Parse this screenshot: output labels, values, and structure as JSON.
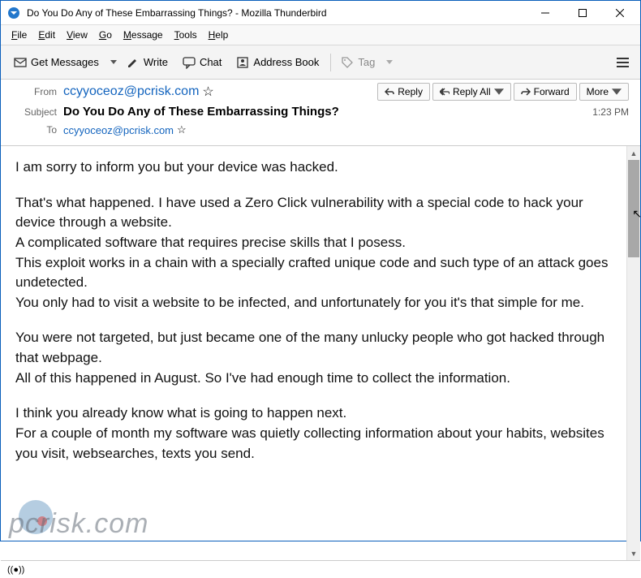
{
  "window": {
    "title": "Do You Do Any of These Embarrassing Things? - Mozilla Thunderbird"
  },
  "menubar": {
    "file": "File",
    "edit": "Edit",
    "view": "View",
    "go": "Go",
    "message": "Message",
    "tools": "Tools",
    "help": "Help"
  },
  "toolbar": {
    "get": "Get Messages",
    "write": "Write",
    "chat": "Chat",
    "addrbook": "Address Book",
    "tag": "Tag"
  },
  "actions": {
    "reply": "Reply",
    "replyall": "Reply All",
    "forward": "Forward",
    "more": "More"
  },
  "headers": {
    "from_label": "From",
    "from": "ccyyoceoz@pcrisk.com",
    "subject_label": "Subject",
    "subject": "Do You Do Any of These Embarrassing Things?",
    "to_label": "To",
    "to": "ccyyoceoz@pcrisk.com",
    "time": "1:23 PM"
  },
  "body": {
    "p1": "I am sorry to inform you but your device was hacked.",
    "p2": "That's what happened. I have used a Zero Click vulnerability with a special code to hack your device through a website.\nA complicated software that requires precise skills that I posess.\nThis exploit works in a chain with a specially crafted unique code and such type of an attack goes undetected.\nYou only had to visit a website to be infected, and unfortunately for you it's that simple for me.",
    "p3": "You were not targeted, but just became one of the many unlucky people who got hacked through that webpage.\nAll of this happened in August. So I've had enough time to collect the information.",
    "p4": "I think you already know what is going to happen next.\nFor a couple of month my software was quietly collecting information about your habits, websites you visit, websearches, texts you send."
  },
  "watermark": "pcrisk.com"
}
